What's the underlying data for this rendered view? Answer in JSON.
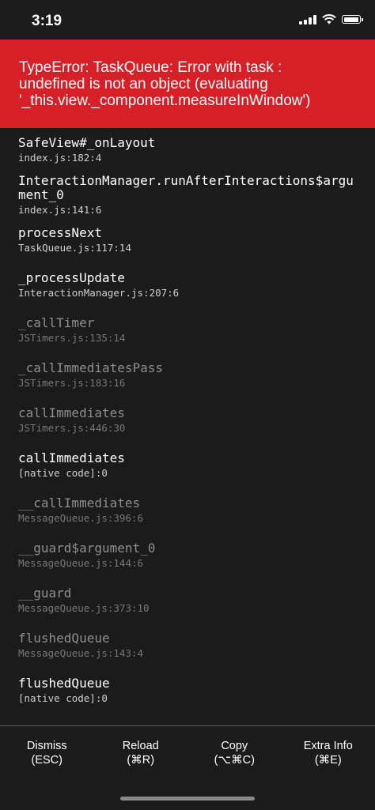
{
  "status_bar": {
    "time": "3:19",
    "battery_level": 1.0
  },
  "error": {
    "message": "TypeError: TaskQueue: Error with task :\nundefined is not an object (evaluating\n'_this.view._component.measureInWindow')"
  },
  "stack": [
    {
      "method": "SafeView#_onLayout",
      "location": "index.js:182:4",
      "dim": false
    },
    {
      "method": "InteractionManager.runAfterInteractions$argument_0",
      "location": "index.js:141:6",
      "dim": false
    },
    {
      "method": "processNext",
      "location": "TaskQueue.js:117:14",
      "dim": false
    },
    {
      "method": "_processUpdate",
      "location": "InteractionManager.js:207:6",
      "dim": false
    },
    {
      "method": "_callTimer",
      "location": "JSTimers.js:135:14",
      "dim": true
    },
    {
      "method": "_callImmediatesPass",
      "location": "JSTimers.js:183:16",
      "dim": true
    },
    {
      "method": "callImmediates",
      "location": "JSTimers.js:446:30",
      "dim": true
    },
    {
      "method": "callImmediates",
      "location": "[native code]:0",
      "dim": false
    },
    {
      "method": "__callImmediates",
      "location": "MessageQueue.js:396:6",
      "dim": true
    },
    {
      "method": "__guard$argument_0",
      "location": "MessageQueue.js:144:6",
      "dim": true
    },
    {
      "method": "__guard",
      "location": "MessageQueue.js:373:10",
      "dim": true
    },
    {
      "method": "flushedQueue",
      "location": "MessageQueue.js:143:4",
      "dim": true
    },
    {
      "method": "flushedQueue",
      "location": "[native code]:0",
      "dim": false
    }
  ],
  "footer": {
    "dismiss": "Dismiss\n(ESC)",
    "reload": "Reload\n(⌘R)",
    "copy": "Copy\n(⌥⌘C)",
    "extra_info": "Extra Info\n(⌘E)"
  },
  "colors": {
    "header_red": "#d71f27",
    "background": "#1b1b1b",
    "dim_text": "#8e8e8e"
  }
}
